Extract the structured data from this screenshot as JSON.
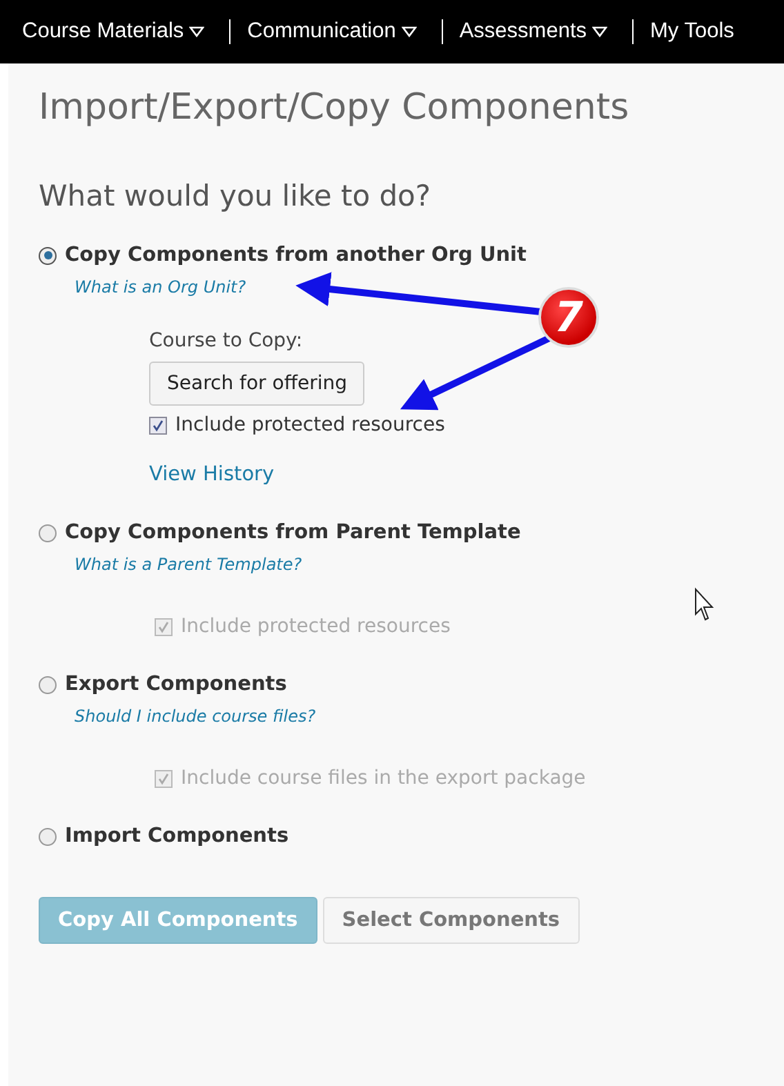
{
  "nav": {
    "items": [
      {
        "label": "Course Materials",
        "dropdown": true
      },
      {
        "label": "Communication",
        "dropdown": true
      },
      {
        "label": "Assessments",
        "dropdown": true
      },
      {
        "label": "My Tools",
        "dropdown": false
      }
    ]
  },
  "title": "Import/Export/Copy Components",
  "question": "What would you like to do?",
  "options": [
    {
      "label": "Copy Components from another Org Unit",
      "selected": true,
      "help": "What is an Org Unit?",
      "field_label": "Course to Copy:",
      "button": "Search for offering",
      "checkbox": {
        "label": "Include protected resources",
        "checked": true,
        "disabled": false
      },
      "link": "View History"
    },
    {
      "label": "Copy Components from Parent Template",
      "selected": false,
      "help": "What is a Parent Template?",
      "checkbox": {
        "label": "Include protected resources",
        "checked": true,
        "disabled": true
      }
    },
    {
      "label": "Export Components",
      "selected": false,
      "help": "Should I include course files?",
      "checkbox": {
        "label": "Include course files in the export package",
        "checked": true,
        "disabled": true
      }
    },
    {
      "label": "Import Components",
      "selected": false
    }
  ],
  "buttons": [
    {
      "label": "Copy All Components",
      "kind": "primary"
    },
    {
      "label": "Select Components",
      "kind": "secondary"
    }
  ],
  "callout": {
    "number": "7"
  }
}
